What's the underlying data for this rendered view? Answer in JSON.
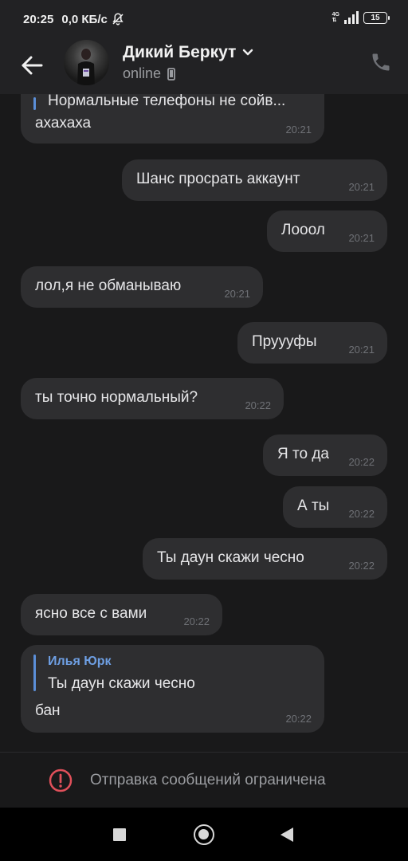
{
  "status_bar": {
    "time": "20:25",
    "speed": "0,0 КБ/с",
    "network": "4G",
    "battery": "15"
  },
  "header": {
    "name": "Дикий Беркут",
    "status": "online"
  },
  "messages": [
    {
      "side": "left",
      "text": "ахахаха",
      "time": "20:21",
      "reply_preview": "Нормальные телефоны не сойв..."
    },
    {
      "side": "right",
      "text": "Шанс просрать аккаунт",
      "time": "20:21"
    },
    {
      "side": "right",
      "text": "Лооол",
      "time": "20:21"
    },
    {
      "side": "left",
      "text": "лол,я не обманываю",
      "time": "20:21"
    },
    {
      "side": "right",
      "text": "Пруууфы",
      "time": "20:21"
    },
    {
      "side": "left",
      "text": "ты точно нормальный?",
      "time": "20:22"
    },
    {
      "side": "right",
      "text": "Я то да",
      "time": "20:22"
    },
    {
      "side": "right",
      "text": "А ты",
      "time": "20:22"
    },
    {
      "side": "right",
      "text": "Ты даун скажи чесно",
      "time": "20:22"
    },
    {
      "side": "left",
      "text": "ясно все с вами",
      "time": "20:22"
    },
    {
      "side": "left",
      "text": "бан",
      "time": "20:22",
      "reply_name": "Илья Юрк",
      "reply_text": "Ты даун скажи чесно"
    }
  ],
  "restriction": {
    "text": "Отправка сообщений ограничена"
  },
  "colors": {
    "bubble": "#2e2e30",
    "accent": "#6e9fe3",
    "warning": "#e0505a"
  }
}
